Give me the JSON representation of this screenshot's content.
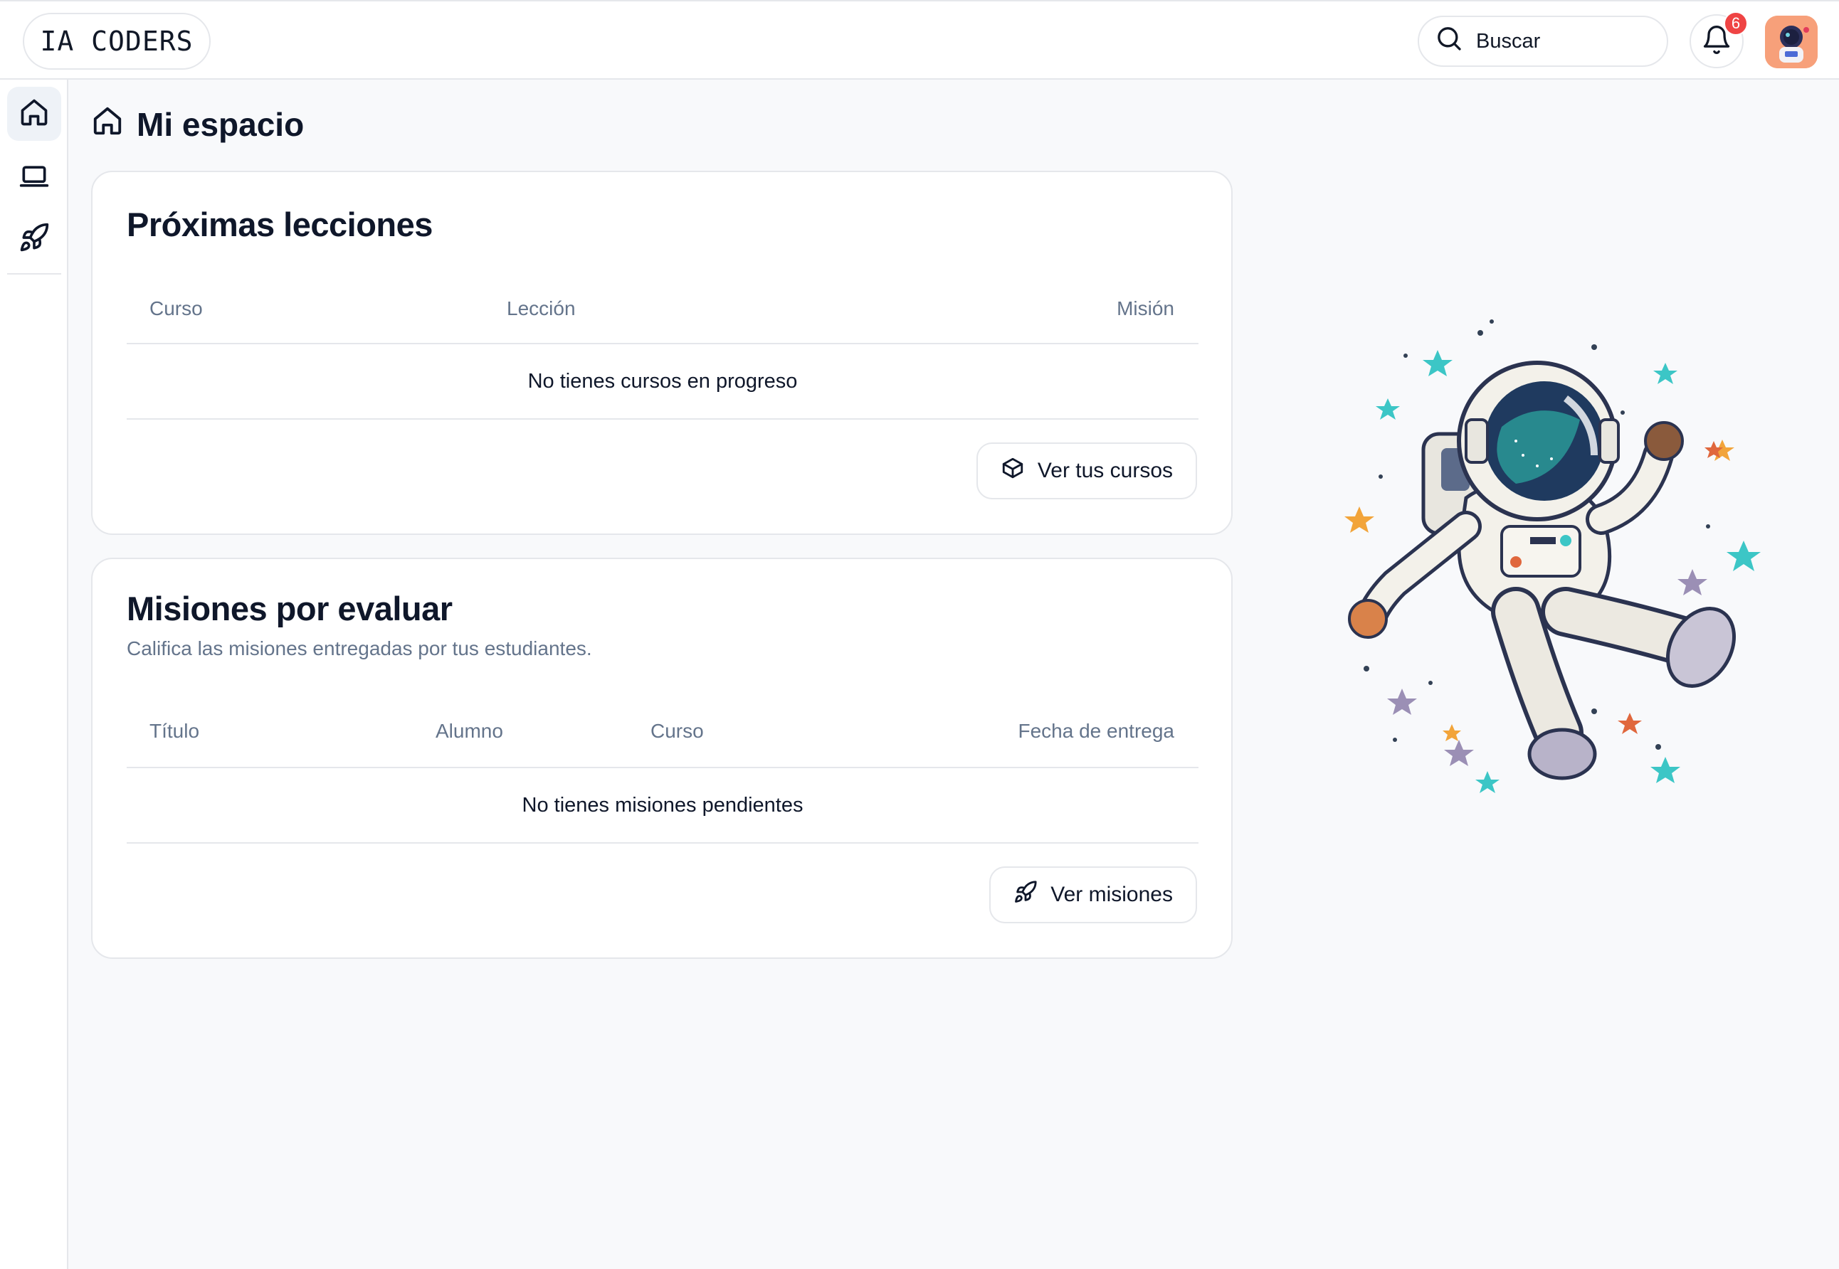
{
  "header": {
    "logo": "IA CODERS",
    "search_placeholder": "Buscar",
    "notification_count": "6"
  },
  "sidebar": {
    "items": [
      {
        "icon": "home-icon",
        "active": true
      },
      {
        "icon": "laptop-icon",
        "active": false
      },
      {
        "icon": "rocket-icon",
        "active": false
      }
    ]
  },
  "page": {
    "title": "Mi espacio"
  },
  "lessons_card": {
    "title": "Próximas lecciones",
    "columns": [
      "Curso",
      "Lección",
      "Misión"
    ],
    "empty_message": "No tienes cursos en progreso",
    "button_label": "Ver tus cursos"
  },
  "missions_card": {
    "title": "Misiones por evaluar",
    "subtitle": "Califica las misiones entregadas por tus estudiantes.",
    "columns": [
      "Título",
      "Alumno",
      "Curso",
      "Fecha de entrega"
    ],
    "empty_message": "No tienes misiones pendientes",
    "button_label": "Ver misiones"
  },
  "colors": {
    "accent_badge": "#ef4444",
    "text_muted": "#64748b",
    "border": "#e5e7eb"
  }
}
